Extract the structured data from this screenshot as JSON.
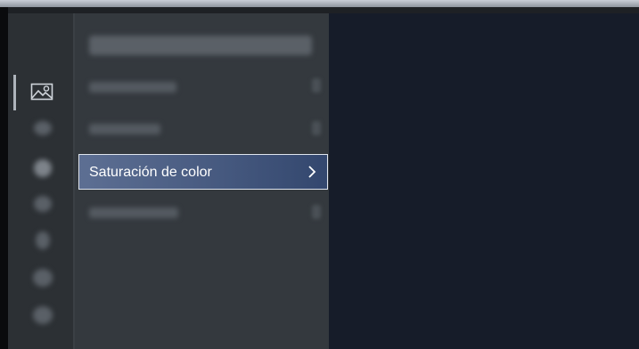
{
  "menu": {
    "selected_item_label": "Saturación de color"
  },
  "icons": {
    "rail": [
      "picture-icon",
      "sound-icon",
      "connection-icon",
      "general-icon",
      "network-icon",
      "support-icon",
      "accessibility-icon"
    ],
    "selected_chevron": "chevron-right-icon"
  },
  "colors": {
    "selection_fill": "#475a80",
    "selection_border": "#dfe5ee",
    "panel_bg": "#34393e",
    "rail_bg": "#2c3034",
    "content_bg": "#161c29"
  }
}
